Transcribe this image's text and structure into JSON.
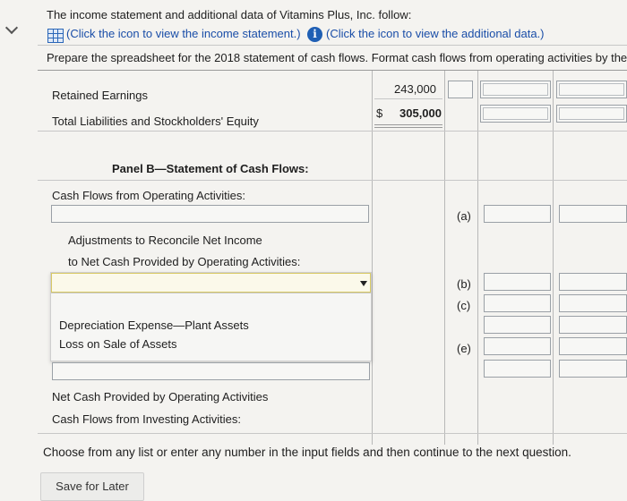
{
  "header": {
    "intro": "The income statement and additional data of Vitamins Plus, Inc. follow:",
    "income_link": "(Click the icon to view the income statement.)",
    "additional_link": "(Click the icon to view the additional data.)",
    "instruction": "Prepare the spreadsheet for the 2018 statement of cash flows. Format cash flows from operating activities by the i"
  },
  "balance": {
    "retained_label": "Retained Earnings",
    "retained_value": "243,000",
    "total_label": "Total Liabilities and Stockholders' Equity",
    "currency": "$",
    "total_value": "305,000"
  },
  "panel_b": {
    "title": "Panel B—Statement of Cash Flows:",
    "cfo_label": "Cash Flows from Operating Activities:",
    "adj_line1": "Adjustments to Reconcile Net Income",
    "adj_line2": "to Net Cash Provided by Operating Activities:",
    "net_cash_label": "Net Cash Provided by Operating Activities",
    "investing_label": "Cash Flows from Investing Activities:"
  },
  "dropdown": {
    "options": [
      "Depreciation Expense—Plant Assets",
      "Loss on Sale of Assets"
    ]
  },
  "markers": {
    "a": "(a)",
    "b": "(b)",
    "c": "(c)",
    "e": "(e)"
  },
  "footer": {
    "instruction": "Choose from any list or enter any number in the input fields and then continue to the next question.",
    "save_label": "Save for Later"
  }
}
